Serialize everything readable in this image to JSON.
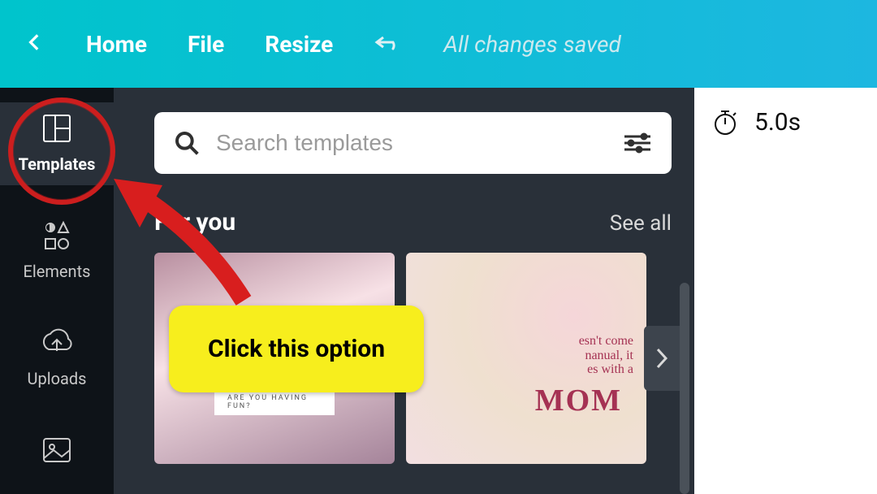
{
  "topbar": {
    "home": "Home",
    "file": "File",
    "resize": "Resize",
    "status": "All changes saved"
  },
  "sidebar": {
    "items": [
      {
        "label": "Templates"
      },
      {
        "label": "Elements"
      },
      {
        "label": "Uploads"
      }
    ]
  },
  "panel": {
    "search_placeholder": "Search templates",
    "section_title": "For you",
    "see_all": "See all",
    "card1_caption": "ARE YOU HAVING FUN?",
    "card2_line": "esn't come\nnanual, it\nes with a",
    "card2_mom": "MOM"
  },
  "canvas": {
    "duration": "5.0s"
  },
  "annotation": {
    "label": "Click this option"
  }
}
